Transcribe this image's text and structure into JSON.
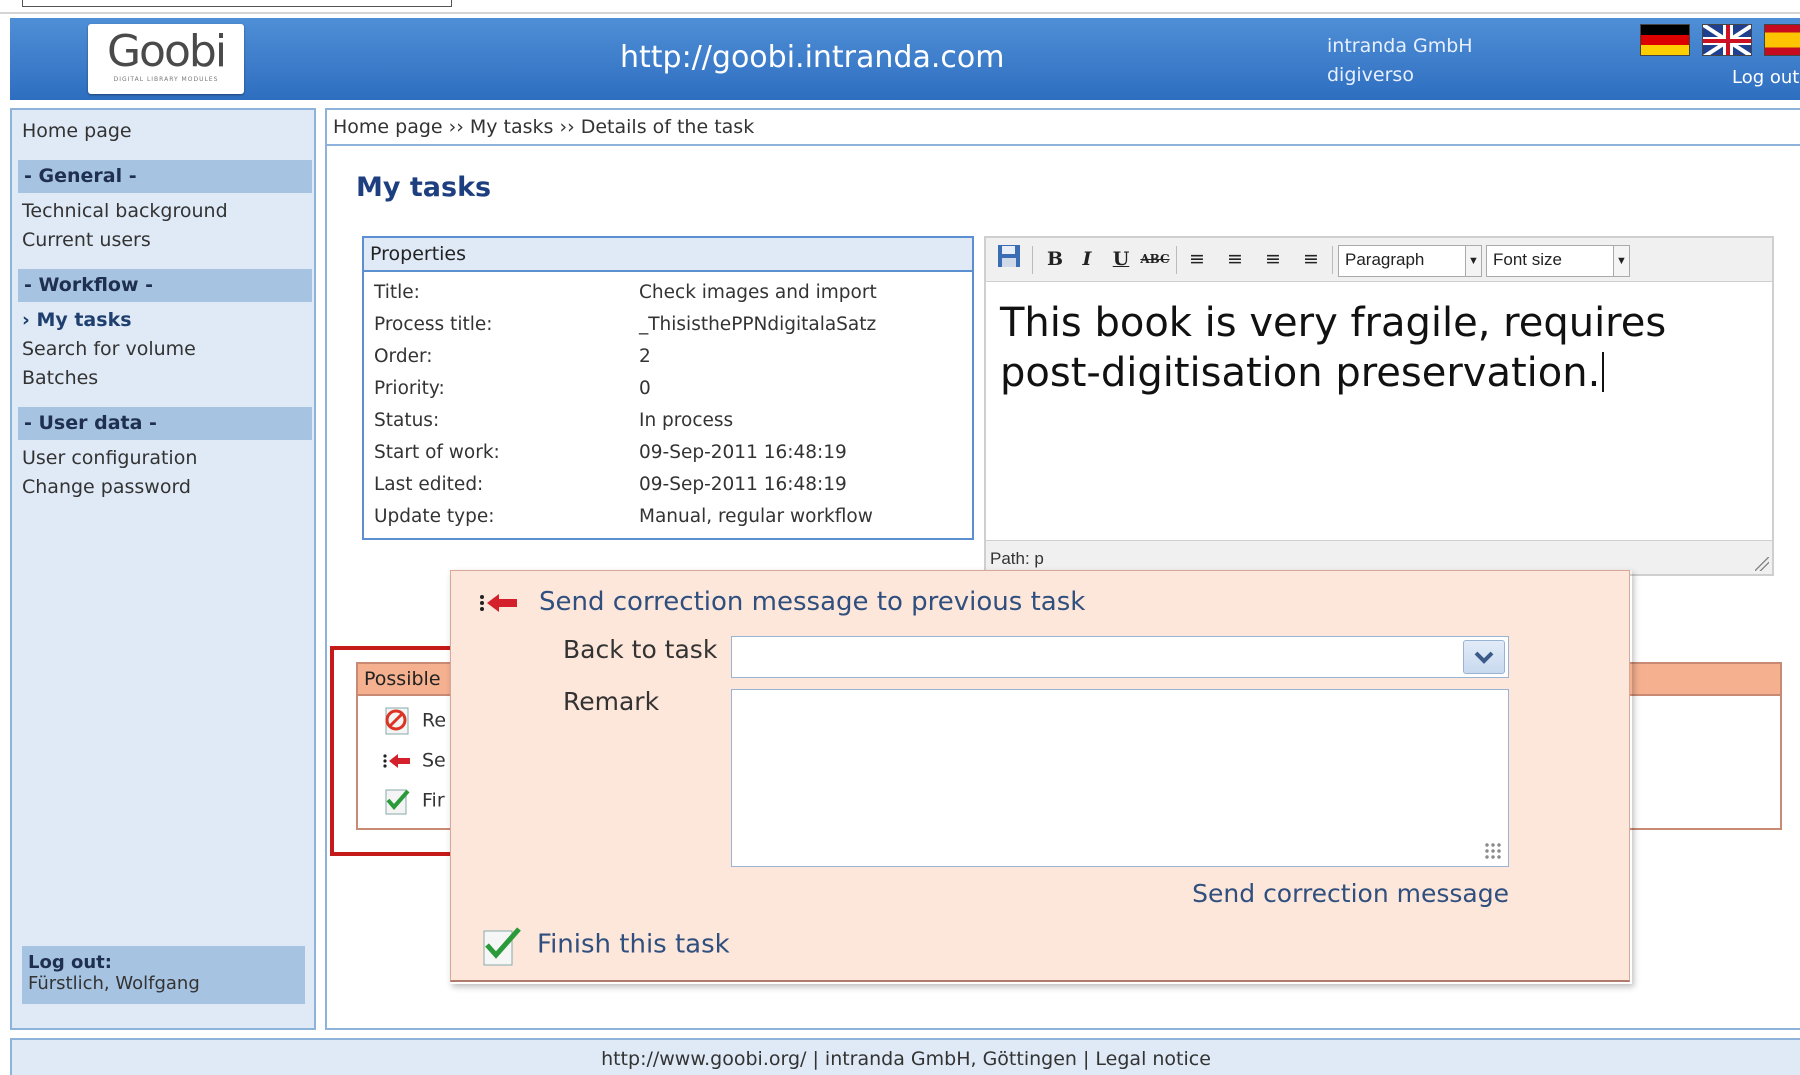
{
  "header": {
    "logo_text": "Goobi",
    "logo_sub": "DIGITAL LIBRARY MODULES",
    "site_url": "http://goobi.intranda.com",
    "company_line1": "intranda GmbH",
    "company_line2": "digiverso",
    "logout_label": "Log out",
    "flags": [
      "german-flag",
      "uk-flag",
      "spanish-flag"
    ]
  },
  "sidebar": {
    "home": "Home page",
    "general_head": "- General -",
    "general_items": [
      "Technical background",
      "Current users"
    ],
    "workflow_head": "- Workflow -",
    "workflow_items": [
      "› My tasks",
      "Search for volume",
      "Batches"
    ],
    "userdata_head": "- User data -",
    "userdata_items": [
      "User configuration",
      "Change password"
    ],
    "logout_label": "Log out:",
    "logout_user": "Fürstlich, Wolfgang"
  },
  "main": {
    "breadcrumb": "Home page ›› My tasks ›› Details of the task",
    "page_title": "My tasks",
    "properties": {
      "heading": "Properties",
      "rows": [
        {
          "label": "Title:",
          "value": "Check images and import"
        },
        {
          "label": "Process title:",
          "value": "_ThisisthePPNdigitalaSatz"
        },
        {
          "label": "Order:",
          "value": "2"
        },
        {
          "label": "Priority:",
          "value": "0"
        },
        {
          "label": "Status:",
          "value": "In process"
        },
        {
          "label": "Start of work:",
          "value": "09-Sep-2011 16:48:19"
        },
        {
          "label": "Last edited:",
          "value": "09-Sep-2011 16:48:19"
        },
        {
          "label": "Update type:",
          "value": "Manual, regular workflow"
        }
      ]
    },
    "editor": {
      "format_select": "Paragraph",
      "fontsize_select": "Font size",
      "text_line1": "This book is very fragile, requires",
      "text_line2": "post-digitisation preservation.",
      "path": "Path: p"
    },
    "possible": {
      "heading": "Possible",
      "items": [
        "Re",
        "Se",
        "Fir"
      ]
    }
  },
  "popup": {
    "send_correction_title": "Send correction message to previous task",
    "back_to_task_label": "Back to task",
    "back_to_task_value": "",
    "remark_label": "Remark",
    "remark_value": "",
    "send_button": "Send correction message",
    "finish_label": "Finish this task"
  },
  "footer": {
    "text": "http://www.goobi.org/ | intranda GmbH, Göttingen | Legal notice"
  },
  "colors": {
    "header_blue": "#2e6ec0",
    "title_blue": "#1d3f7f",
    "popup_bg": "#fde6da",
    "possible_head": "#f4b08f",
    "highlight_red": "#c41a1a"
  }
}
